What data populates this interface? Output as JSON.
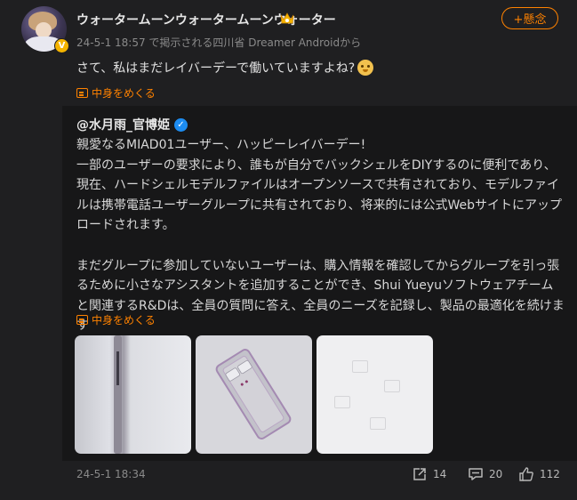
{
  "user": {
    "name": "ウォータームーンウォータームーンウォーター",
    "badge": "V",
    "follow_label": "+懸念",
    "meta": "24-5-1 18:57 で掲示される四川省 Dreamer Androidから",
    "text": "さて、私はまだレイバーデーで働いていますよね?",
    "text_emoji": "dog-emoji"
  },
  "expand_label": "中身をめくる",
  "repost": {
    "author": "@水月雨_官博姫",
    "paragraphs": [
      "親愛なるMIAD01ユーザー、ハッピーレイバーデー!",
      "一部のユーザーの要求により、誰もが自分でバックシェルをDIYするのに便利であり、現在、ハードシェルモデルファイルはオープンソースで共有されており、モデルファイルは携帯電話ユーザーグループに共有されており、将来的には公式Webサイトにアップロードされます。",
      "",
      "まだグループに参加していないユーザーは、購入情報を確認してからグループを引っ張るために小さなアシスタントを追加することができ、Shui Yueyuソフトウェアチームと関連するR&Dは、全員の質問に答え、全員のニーズを記録し、製品の最適化を続けます"
    ],
    "expand_label": "中身をめくる",
    "date": "24-5-1 18:34"
  },
  "actions": {
    "share_count": "14",
    "comment_count": "20",
    "like_count": "112"
  },
  "colors": {
    "accent": "#ff8200",
    "verified": "#1d8cf0",
    "background": "#1f1f21",
    "repost_background": "#171718"
  }
}
